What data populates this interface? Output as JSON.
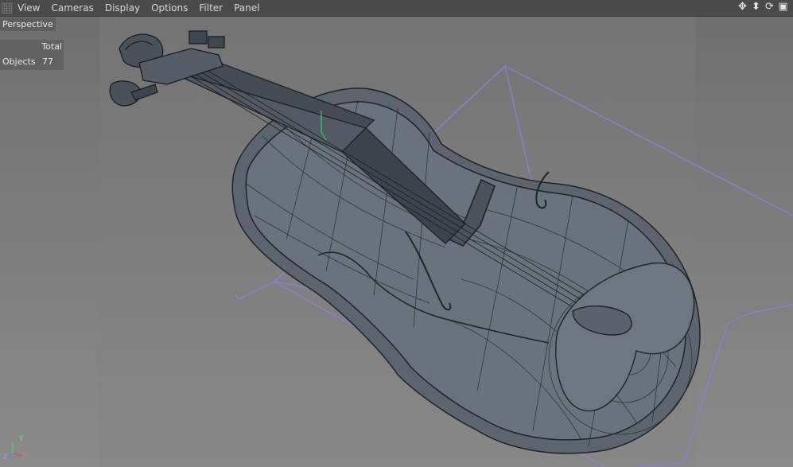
{
  "menu": {
    "items": [
      "View",
      "Cameras",
      "Display",
      "Options",
      "Filter",
      "Panel"
    ]
  },
  "nav_icons": [
    "move-view-icon",
    "zoom-view-icon",
    "rotate-view-icon",
    "toggle-view-icon"
  ],
  "viewport": {
    "label": "Perspective",
    "hud": {
      "header": "Total",
      "row_label": "Objects",
      "row_value": "77"
    }
  },
  "axis_gizmo": {
    "x": "X",
    "y": "Y",
    "z": "Z"
  },
  "colors": {
    "menu_bg": "#4a4a4a",
    "viewport_bg": "#7a7a7a",
    "model_fill": "#5f6670",
    "wire": "#2a2e33",
    "camera_frustum": "#8a7fe0"
  }
}
